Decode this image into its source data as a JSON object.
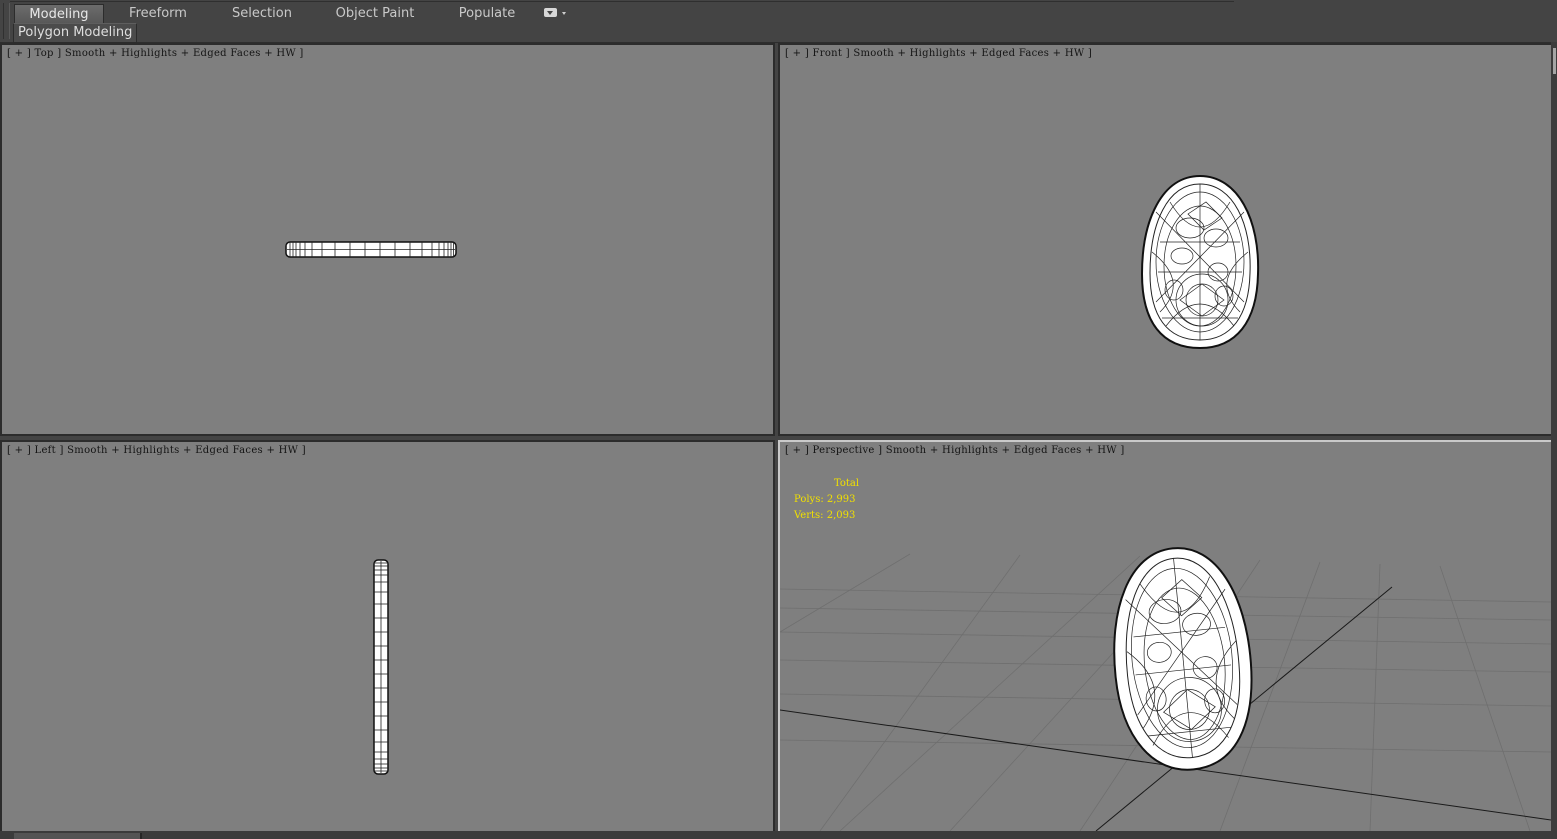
{
  "ribbon": {
    "tabs": [
      {
        "label": "Modeling",
        "active": true
      },
      {
        "label": "Freeform",
        "active": false
      },
      {
        "label": "Selection",
        "active": false
      },
      {
        "label": "Object Paint",
        "active": false
      },
      {
        "label": "Populate",
        "active": false
      }
    ],
    "dropdown_icon": "ribbon-options-icon",
    "panel_label": "Polygon Modeling"
  },
  "viewports": {
    "top": {
      "label": "[ + ] Top ] Smooth + Highlights + Edged Faces + HW ]"
    },
    "front": {
      "label": "[ + ] Front ] Smooth + Highlights + Edged Faces + HW ]"
    },
    "left": {
      "label": "[ + ] Left ] Smooth + Highlights + Edged Faces + HW ]"
    },
    "perspective": {
      "label": "[ + ] Perspective ] Smooth + Highlights + Edged Faces + HW ]",
      "active": true,
      "stats": {
        "total_label": "Total",
        "polys": "Polys: 2,993",
        "verts": "Verts: 2,093"
      }
    }
  },
  "colors": {
    "viewport_bg": "#7f7f7f",
    "ui_bg": "#444444",
    "stats_text": "#f1e000",
    "active_border": "#c9c9c9"
  }
}
